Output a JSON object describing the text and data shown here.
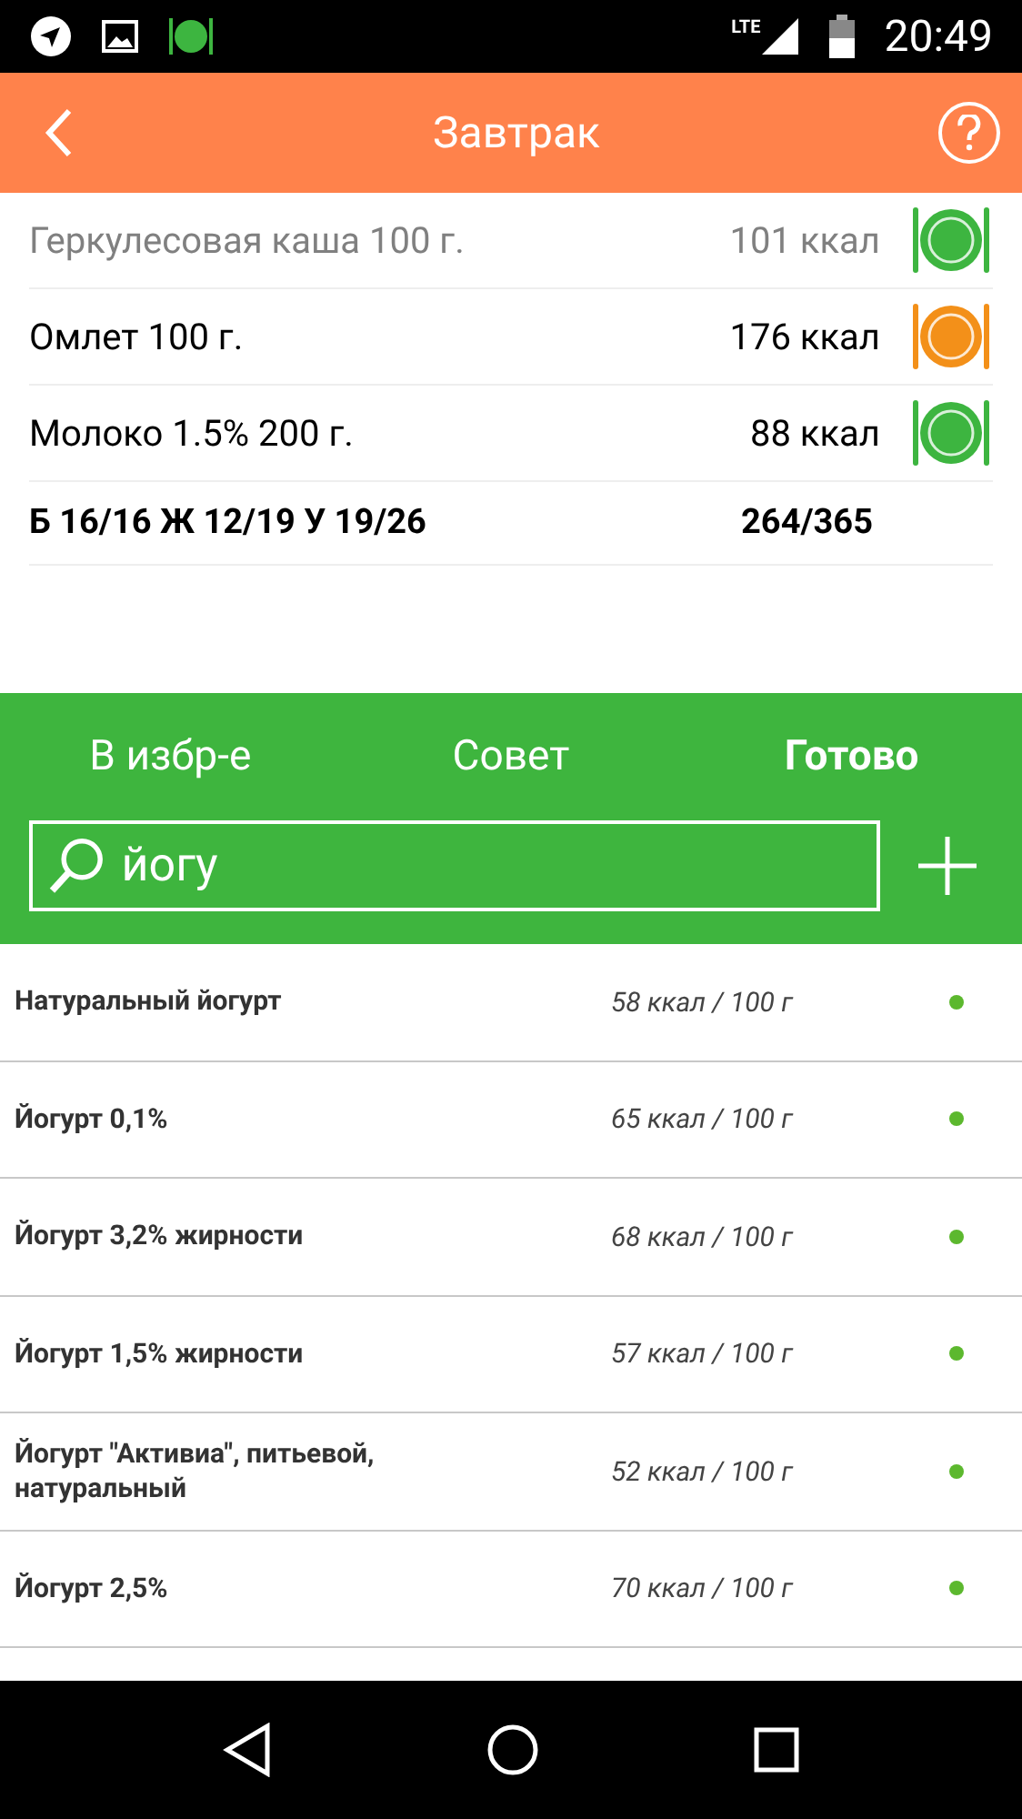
{
  "status_bar": {
    "network": "LTE",
    "time": "20:49"
  },
  "header": {
    "title": "Завтрак"
  },
  "meal_items": [
    {
      "name": "Геркулесовая каша 100 г.",
      "calories": "101 ккал",
      "dimmed": true,
      "color": "#3db540"
    },
    {
      "name": "Омлет 100 г.",
      "calories": "176 ккал",
      "dimmed": false,
      "color": "#f39019"
    },
    {
      "name": "Молоко 1.5% 200 г.",
      "calories": "88 ккал",
      "dimmed": false,
      "color": "#3db540"
    }
  ],
  "summary": {
    "macros": "Б 16/16 Ж 12/19 У 19/26",
    "calories": "264/365"
  },
  "actions": [
    {
      "label": "В избр-е",
      "kind": "plain"
    },
    {
      "label": "Совет",
      "kind": "plain"
    },
    {
      "label": "Готово",
      "kind": "primary"
    }
  ],
  "search": {
    "value": "йогу"
  },
  "results": [
    {
      "name": "Натуральный йогурт",
      "calories": "58 ккал / 100 г"
    },
    {
      "name": "Йогурт 0,1%",
      "calories": "65 ккал / 100 г"
    },
    {
      "name": "Йогурт 3,2% жирности",
      "calories": "68 ккал / 100 г"
    },
    {
      "name": "Йогурт 1,5% жирности",
      "calories": "57 ккал / 100 г"
    },
    {
      "name": "Йогурт \"Активиа\", питьевой, натуральный",
      "calories": "52 ккал / 100 г"
    },
    {
      "name": "Йогурт 2,5%",
      "calories": "70 ккал / 100 г"
    }
  ]
}
